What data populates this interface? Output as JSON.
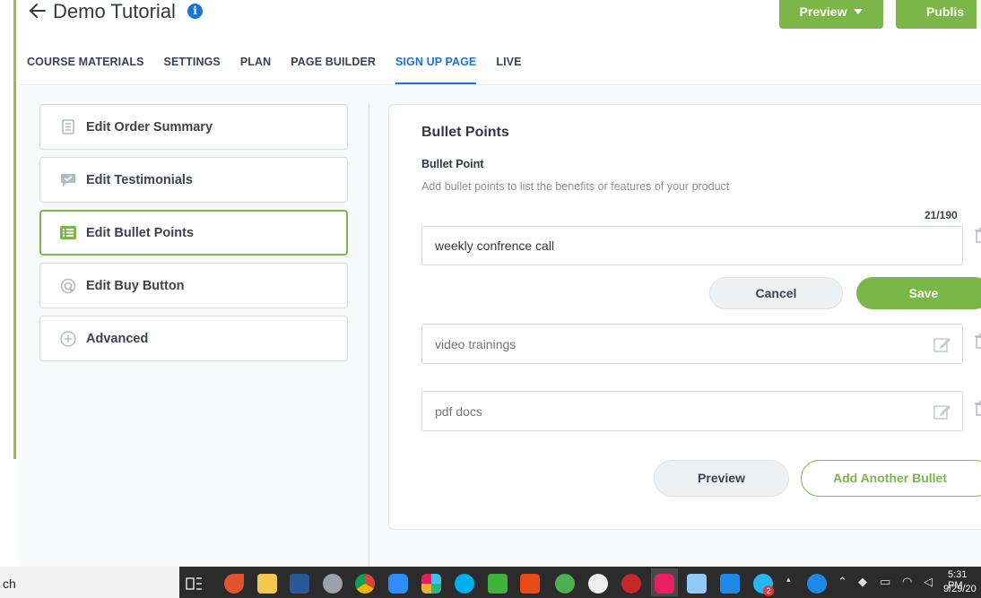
{
  "header": {
    "title": "Demo Tutorial",
    "preview_label": "Preview",
    "publish_label": "Publis",
    "accent": "#7ab648",
    "link_color": "#1d73d4",
    "tabs": [
      {
        "label": "COURSE MATERIALS",
        "active": false
      },
      {
        "label": "SETTINGS",
        "active": false
      },
      {
        "label": "PLAN",
        "active": false
      },
      {
        "label": "PAGE BUILDER",
        "active": false
      },
      {
        "label": "SIGN UP PAGE",
        "active": true
      },
      {
        "label": "LIVE",
        "active": false
      }
    ]
  },
  "sidebar": {
    "items": [
      {
        "label": "Edit Order Summary",
        "icon": "document-list-icon",
        "active": false
      },
      {
        "label": "Edit Testimonials",
        "icon": "chat-bubble-icon",
        "active": false
      },
      {
        "label": "Edit Bullet Points",
        "icon": "list-icon",
        "active": true
      },
      {
        "label": "Edit Buy Button",
        "icon": "cursor-click-icon",
        "active": false
      },
      {
        "label": "Advanced",
        "icon": "plus-circle-icon",
        "active": false
      }
    ]
  },
  "editor": {
    "title": "Bullet Points",
    "field_label": "Bullet Point",
    "help_text": "Add bullet points to list the benefits or features of your product",
    "char_count": "21/190",
    "editing_value": "weekly confrence call",
    "cancel_label": "Cancel",
    "save_label": "Save",
    "bullets": [
      "video trainings",
      "pdf docs"
    ],
    "preview_label": "Preview",
    "add_label": "Add Another Bullet"
  },
  "taskbar": {
    "search_stub": "ch",
    "clock_time": "5:31 PM",
    "clock_date": "9/29/20",
    "notification_count": "2"
  }
}
